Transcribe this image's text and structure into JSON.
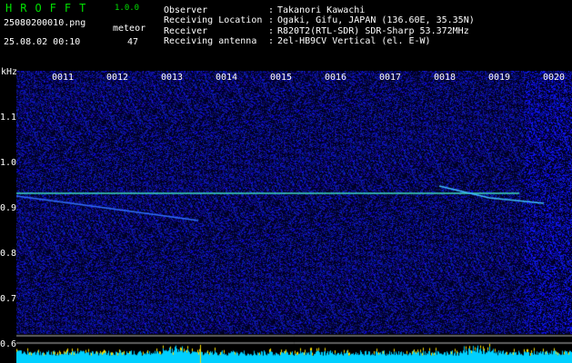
{
  "app": {
    "title": "HROFFT",
    "version": "1.0.0"
  },
  "file": {
    "name": "25080200010.png",
    "datetime": "25.08.02 00:10"
  },
  "meteor": {
    "label": "meteor",
    "count": "47"
  },
  "info": [
    {
      "label": "Observer",
      "sep": ":",
      "value": "Takanori Kawachi"
    },
    {
      "label": "Receiving Location",
      "sep": ":",
      "value": "Ogaki, Gifu, JAPAN (136.60E, 35.35N)"
    },
    {
      "label": "Receiver",
      "sep": ":",
      "value": "R820T2(RTL-SDR) SDR-Sharp 53.372MHz"
    },
    {
      "label": "Receiving antenna",
      "sep": ":",
      "value": "2el-HB9CV Vertical (el. E-W)"
    }
  ],
  "axis": {
    "y_unit": "kHz",
    "y_ticks": [
      "1.1",
      "1.0",
      "0.9",
      "0.8",
      "0.7",
      "0.6"
    ],
    "x_ticks": [
      "0011",
      "0012",
      "0013",
      "0014",
      "0015",
      "0016",
      "0017",
      "0018",
      "0019",
      "0020"
    ]
  },
  "colors": {
    "background": "#000000",
    "logo": "#00e000",
    "noise": "#1a1aa0",
    "echo": "#40e0c0",
    "power_bar": "#00d0ff",
    "power_peak": "#ffe000"
  }
}
